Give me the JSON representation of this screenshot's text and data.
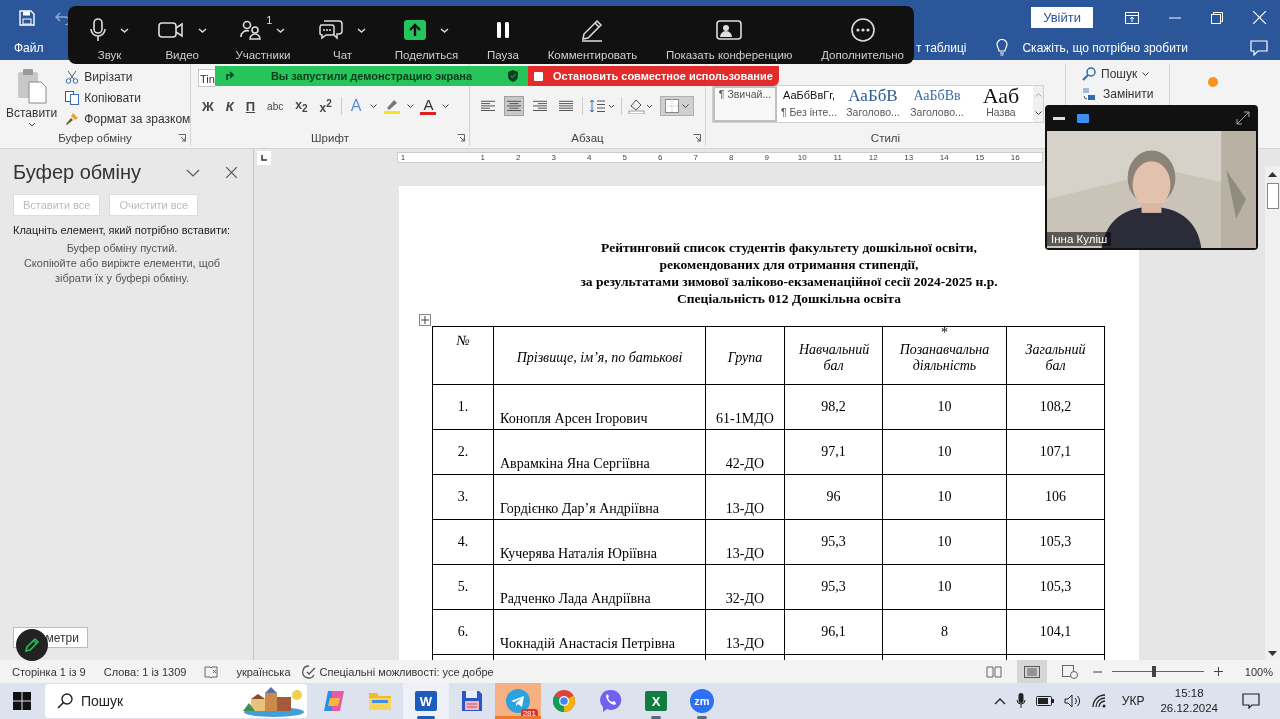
{
  "titlebar": {
    "signin": "Увійти"
  },
  "tabs": [
    {
      "label": "Файл",
      "selected": false
    },
    {
      "label": "т таблиці",
      "selected": false
    }
  ],
  "tell_me": "Скажіть, що потрібно зробити",
  "clipboard_group": {
    "paste": "Вставити",
    "actions": [
      "Вирізати",
      "Копіювати",
      "Формат за зразком"
    ],
    "label": "Буфер обміну"
  },
  "font_group": {
    "font": "Tin",
    "buttons": [
      "Ж",
      "К",
      "П",
      "abc",
      "x$_{2}$",
      "x$^{2}$"
    ],
    "text_effect": "A",
    "font_color": "A",
    "label": "Шрифт"
  },
  "paragraph_group": {
    "align": [
      {
        "selected": false
      },
      {
        "selected": true
      },
      {
        "selected": false
      },
      {
        "selected": false
      }
    ],
    "label": "Абзац"
  },
  "styles": {
    "items": [
      {
        "name": "¶ Звичай...",
        "selected": true
      },
      {
        "preview": "АаБбВвГг,",
        "name": "¶ Без інте...",
        "kind": "normal",
        "selected": false
      },
      {
        "preview": "АаБбВ",
        "name": "Заголово...",
        "kind": "heading1",
        "selected": false
      },
      {
        "preview": "АаБбВв",
        "name": "Заголово...",
        "kind": "heading2",
        "selected": false
      },
      {
        "preview": "Ааб",
        "name": "Назва",
        "kind": "title",
        "selected": false
      }
    ],
    "label": "Стилі"
  },
  "editing": {
    "find": "Пошук",
    "replace": "Замінити"
  },
  "zoom_toolbar": {
    "items": [
      {
        "label": "Звук",
        "kind": "audio",
        "caret": true
      },
      {
        "label": "Видео",
        "kind": "video",
        "caret": true
      },
      {
        "label": "Участники",
        "kind": "participants",
        "caret": true,
        "count": "1"
      },
      {
        "label": "Чат",
        "kind": "chat",
        "caret": true
      },
      {
        "label": "Поделиться",
        "kind": "share",
        "caret": true
      },
      {
        "label": "Пауза",
        "kind": "pause",
        "caret": false
      },
      {
        "label": "Комментировать",
        "kind": "annotate",
        "caret": false
      },
      {
        "label": "Показать конференцию",
        "kind": "show",
        "caret": false
      },
      {
        "label": "Дополнительно",
        "kind": "more",
        "caret": false
      }
    ]
  },
  "share_banner": {
    "message": "Вы запустили демонстрацию экрана",
    "stop": "Остановить совместное использование"
  },
  "video_window": {
    "name": "Інна Куліш"
  },
  "clipboard_pane": {
    "title": "Буфер обміну",
    "buttons": [
      {
        "label": "Вставити все",
        "disabled": true
      },
      {
        "label": "Очистити все",
        "disabled": true
      }
    ],
    "instruction": "Клацніть елемент, який потрібно вставити:",
    "empty": [
      "Буфер обміну пустий.",
      "Скопіюйте або виріжте елементи, щоб зібрати їх у буфері обміну."
    ],
    "options": "метри"
  },
  "ruler": [
    "1",
    "1",
    "2",
    "3",
    "4",
    "5",
    "6",
    "7",
    "8",
    "9",
    "10",
    "11",
    "12",
    "13",
    "14",
    "15",
    "16"
  ],
  "document": {
    "title_lines": [
      "Рейтинговий список студентів факультету дошкільної освіти,",
      "рекомендованих для отримання стипендії,",
      "за результатами зимової заліково-екзаменаційної  сесії 2024-2025 н.р.",
      "Спеціальність 012 Дошкільна освіта"
    ],
    "table": {
      "columns": [
        {
          "label": "№"
        },
        {
          "label": "Прізвище, ім’я, по батькові"
        },
        {
          "label": "Група"
        },
        {
          "label": "Навчальний бал"
        },
        {
          "label": "Позанавчальна діяльність",
          "note": "*"
        },
        {
          "label": "Загальний бал"
        }
      ],
      "rows": [
        [
          "1.",
          "Конопля Арсен Ігорович",
          "61-1МДО",
          "98,2",
          "10",
          "108,2"
        ],
        [
          "2.",
          "Аврамкіна Яна Сергіївна",
          "42-ДО",
          "97,1",
          "10",
          "107,1"
        ],
        [
          "3.",
          "Гордієнко Дар’я Андріївна",
          "13-ДО",
          "96",
          "10",
          "106"
        ],
        [
          "4.",
          "Кучерява Наталія Юріївна",
          "13-ДО",
          "95,3",
          "10",
          "105,3"
        ],
        [
          "5.",
          "Радченко Лада Андріївна",
          "32-ДО",
          "95,3",
          "10",
          "105,3"
        ],
        [
          "6.",
          "Чокнадій Анастасія Петрівна",
          "13-ДО",
          "96,1",
          "8",
          "104,1"
        ]
      ]
    }
  },
  "status_bar": {
    "page": "Сторінка 1 із 9",
    "words": "Слова: 1 із 1309",
    "language": "українська",
    "accessibility": "Спеціальні можливості: усе добре",
    "views": [
      {
        "selected": false
      },
      {
        "selected": true
      },
      {
        "selected": false
      }
    ],
    "zoom": {
      "level": 0.46,
      "reading": "100%"
    }
  },
  "taskbar": {
    "search": "Пошук",
    "apps": [
      {
        "kind": "copilot",
        "running": false,
        "selected": false,
        "flashing": false
      },
      {
        "kind": "explorer",
        "running": false,
        "selected": false,
        "flashing": false
      },
      {
        "kind": "word",
        "glyph": "W",
        "running": true,
        "selected": true,
        "flashing": false
      },
      {
        "kind": "save",
        "running": false,
        "selected": false,
        "flashing": false
      },
      {
        "kind": "telegram",
        "badge": "281",
        "running": true,
        "selected": false,
        "flashing": true
      },
      {
        "kind": "chrome",
        "running": false,
        "selected": false,
        "flashing": false
      },
      {
        "kind": "viber",
        "running": false,
        "selected": false,
        "flashing": false
      },
      {
        "kind": "excel",
        "glyph": "X",
        "running": true,
        "selected": false,
        "flashing": false
      },
      {
        "kind": "zoom",
        "glyph": "zm",
        "running": true,
        "selected": false,
        "flashing": false
      }
    ],
    "language": "УКР",
    "time": "15:18",
    "date": "26.12.2024"
  }
}
